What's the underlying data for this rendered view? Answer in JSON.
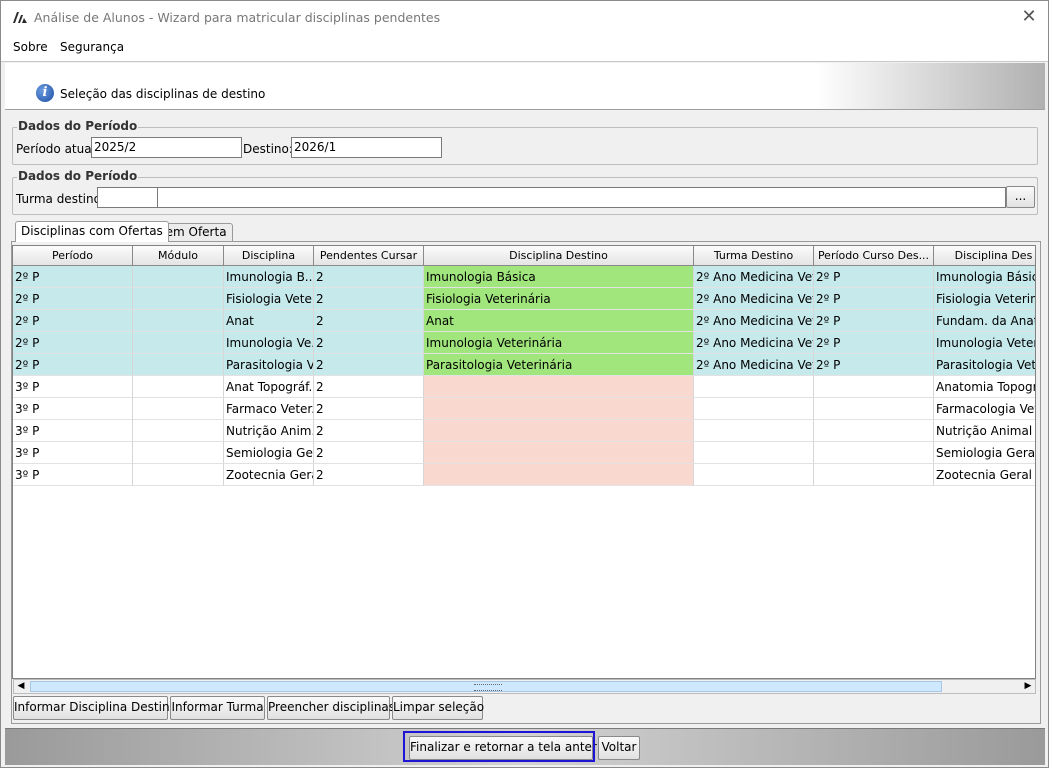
{
  "window": {
    "title": "Análise de Alunos - Wizard para matricular disciplinas pendentes",
    "close_glyph": "✕",
    "app_icon": "app-logo-icon"
  },
  "menu": {
    "items": [
      {
        "label": "Sobre"
      },
      {
        "label": "Segurança"
      }
    ]
  },
  "header": {
    "text": "Seleção das disciplinas de destino",
    "icon": "info-icon"
  },
  "periodo_group": {
    "title": "Dados do Período",
    "atual_label": "Período atual:",
    "atual_value": "2025/2",
    "destino_label": "Destino:",
    "destino_value": "2026/1"
  },
  "turma_group": {
    "title": "Dados do Período",
    "label": "Turma destino:",
    "code_value": "",
    "name_value": "",
    "browse_label": "..."
  },
  "tabs": [
    {
      "label": "Disciplinas com Ofertas",
      "active": true
    },
    {
      "label": "Sem Oferta",
      "active": false
    }
  ],
  "grid": {
    "columns": [
      "Período",
      "Módulo",
      "Disciplina",
      "Pendentes Cursar",
      "Disciplina Destino",
      "Turma Destino",
      "Período Curso Des...",
      "Disciplina Des"
    ],
    "colors": {
      "offered_row": "#c6e9ec",
      "destino_ok": "#a1e67d",
      "destino_missing": "#f9d9cf"
    },
    "rows": [
      {
        "periodo": "2º P",
        "modulo": "",
        "disciplina": "Imunologia B...",
        "pendentes": "2",
        "destino": "Imunologia Básica",
        "turma": "2º Ano Medicina Vet...",
        "periodo_curso": "2º P",
        "disc_des": "Imunologia Básica",
        "status": "ok"
      },
      {
        "periodo": "2º P",
        "modulo": "",
        "disciplina": "Fisiologia Vete...",
        "pendentes": "2",
        "destino": "Fisiologia Veterinária",
        "turma": "2º Ano Medicina Vet...",
        "periodo_curso": "2º P",
        "disc_des": "Fisiologia Veterinár",
        "status": "ok"
      },
      {
        "periodo": "2º P",
        "modulo": "",
        "disciplina": "Anat",
        "pendentes": "2",
        "destino": "Anat",
        "turma": "2º Ano Medicina Vet...",
        "periodo_curso": "2º P",
        "disc_des": "Fundam. da Anator",
        "status": "ok"
      },
      {
        "periodo": "2º P",
        "modulo": "",
        "disciplina": "Imunologia Ve...",
        "pendentes": "2",
        "destino": "Imunologia Veterinária",
        "turma": "2º Ano Medicina Vet...",
        "periodo_curso": "2º P",
        "disc_des": "Imunologia Veterin",
        "status": "ok"
      },
      {
        "periodo": "2º P",
        "modulo": "",
        "disciplina": "Parasitologia V...",
        "pendentes": "2",
        "destino": "Parasitologia Veterinária",
        "turma": "2º Ano Medicina Vet...",
        "periodo_curso": "2º P",
        "disc_des": "Parasitologia Veteri",
        "status": "ok"
      },
      {
        "periodo": "3º P",
        "modulo": "",
        "disciplina": "Anat Topográf...",
        "pendentes": "2",
        "destino": "",
        "turma": "",
        "periodo_curso": "",
        "disc_des": "Anatomia Topográ",
        "status": "missing"
      },
      {
        "periodo": "3º P",
        "modulo": "",
        "disciplina": "Farmaco Veter...",
        "pendentes": "2",
        "destino": "",
        "turma": "",
        "periodo_curso": "",
        "disc_des": "Farmacologia Veter",
        "status": "missing"
      },
      {
        "periodo": "3º P",
        "modulo": "",
        "disciplina": "Nutrição Anim...",
        "pendentes": "2",
        "destino": "",
        "turma": "",
        "periodo_curso": "",
        "disc_des": "Nutrição Animal I",
        "status": "missing"
      },
      {
        "periodo": "3º P",
        "modulo": "",
        "disciplina": "Semiologia Ge...",
        "pendentes": "2",
        "destino": "",
        "turma": "",
        "periodo_curso": "",
        "disc_des": "Semiologia Geral Ve",
        "status": "missing"
      },
      {
        "periodo": "3º P",
        "modulo": "",
        "disciplina": "Zootecnia Geral",
        "pendentes": "2",
        "destino": "",
        "turma": "",
        "periodo_curso": "",
        "disc_des": "Zootecnia Geral",
        "status": "missing"
      }
    ]
  },
  "scrollbar": {
    "left_arrow": "◀",
    "right_arrow": "▶"
  },
  "actions": {
    "informar_disciplina": "Informar Disciplina Destino",
    "informar_turma": "Informar Turma",
    "preencher": "Preencher disciplinas",
    "limpar": "Limpar seleção"
  },
  "footer": {
    "finalizar": "Finalizar e retornar a tela anterior",
    "voltar": "Voltar",
    "highlight_color": "#1d14d4"
  }
}
